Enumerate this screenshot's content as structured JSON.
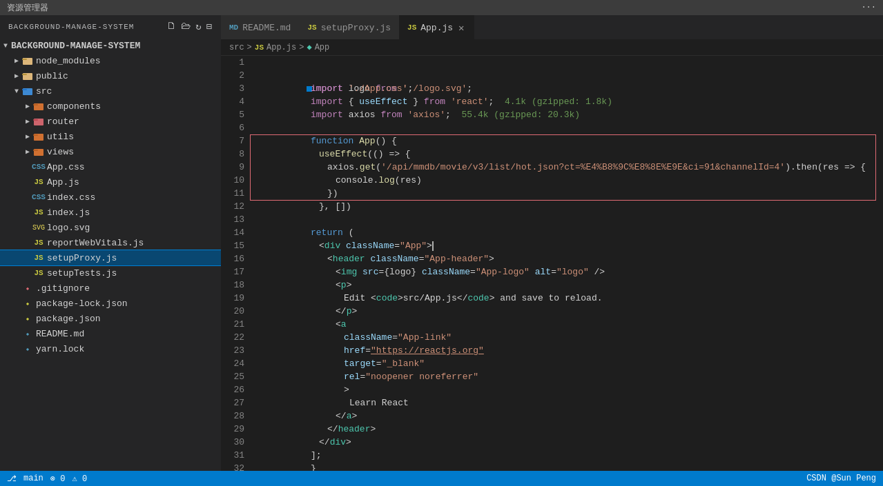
{
  "titlebar": {
    "text": "资源管理器",
    "icons": "..."
  },
  "sidebar": {
    "header": "BACKGROUND-MANAGE-SYSTEM",
    "items": [
      {
        "id": "node_modules",
        "label": "node_modules",
        "indent": 1,
        "arrow": "▶",
        "type": "folder",
        "icon": "📁",
        "iconClass": "icon-folder"
      },
      {
        "id": "public",
        "label": "public",
        "indent": 1,
        "arrow": "▶",
        "type": "folder",
        "icon": "📁",
        "iconClass": "icon-folder"
      },
      {
        "id": "src",
        "label": "src",
        "indent": 1,
        "arrow": "▼",
        "type": "folder-src",
        "icon": "📁",
        "iconClass": "icon-folder-src"
      },
      {
        "id": "components",
        "label": "components",
        "indent": 2,
        "arrow": "▶",
        "type": "folder-components",
        "icon": "📁",
        "iconClass": "icon-folder-components"
      },
      {
        "id": "router",
        "label": "router",
        "indent": 2,
        "arrow": "▶",
        "type": "folder-router",
        "icon": "📁",
        "iconClass": "icon-folder-router"
      },
      {
        "id": "utils",
        "label": "utils",
        "indent": 2,
        "arrow": "▶",
        "type": "folder-utils",
        "icon": "📁",
        "iconClass": "icon-folder-utils"
      },
      {
        "id": "views",
        "label": "views",
        "indent": 2,
        "arrow": "▶",
        "type": "folder-views",
        "icon": "📁",
        "iconClass": "icon-folder-views"
      },
      {
        "id": "App.css",
        "label": "App.css",
        "indent": 2,
        "type": "css",
        "iconClass": "icon-css"
      },
      {
        "id": "App.js",
        "label": "App.js",
        "indent": 2,
        "type": "js",
        "iconClass": "icon-js"
      },
      {
        "id": "index.css",
        "label": "index.css",
        "indent": 2,
        "type": "css",
        "iconClass": "icon-css"
      },
      {
        "id": "index.js",
        "label": "index.js",
        "indent": 2,
        "type": "js",
        "iconClass": "icon-js"
      },
      {
        "id": "logo.svg",
        "label": "logo.svg",
        "indent": 2,
        "type": "svg",
        "iconClass": "icon-svg"
      },
      {
        "id": "reportWebVitals.js",
        "label": "reportWebVitals.js",
        "indent": 2,
        "type": "js",
        "iconClass": "icon-js"
      },
      {
        "id": "setupProxy.js",
        "label": "setupProxy.js",
        "indent": 2,
        "type": "js",
        "iconClass": "icon-js",
        "selected": true
      },
      {
        "id": "setupTests.js",
        "label": "setupTests.js",
        "indent": 2,
        "type": "js",
        "iconClass": "icon-js"
      },
      {
        "id": ".gitignore",
        "label": ".gitignore",
        "indent": 1,
        "type": "git",
        "iconClass": "icon-git"
      },
      {
        "id": "package-lock.json",
        "label": "package-lock.json",
        "indent": 1,
        "type": "json",
        "iconClass": "icon-lock"
      },
      {
        "id": "package.json",
        "label": "package.json",
        "indent": 1,
        "type": "json",
        "iconClass": "icon-json"
      },
      {
        "id": "README.md",
        "label": "README.md",
        "indent": 1,
        "type": "md",
        "iconClass": "icon-md"
      },
      {
        "id": "yarn.lock",
        "label": "yarn.lock",
        "indent": 1,
        "type": "yarn",
        "iconClass": "icon-yarn"
      }
    ]
  },
  "tabs": [
    {
      "id": "readme",
      "label": "README.md",
      "icon": "MD",
      "iconColor": "#519aba",
      "active": false
    },
    {
      "id": "setupProxy",
      "label": "setupProxy.js",
      "icon": "JS",
      "iconColor": "#cbcb41",
      "active": false
    },
    {
      "id": "appjs",
      "label": "App.js",
      "icon": "JS",
      "iconColor": "#cbcb41",
      "active": true,
      "closable": true
    }
  ],
  "breadcrumb": {
    "parts": [
      "src",
      ">",
      "JS",
      "App.js",
      ">",
      "🔷",
      "App"
    ]
  },
  "statusbar": {
    "right_text": "CSDN @Sun  Peng"
  }
}
